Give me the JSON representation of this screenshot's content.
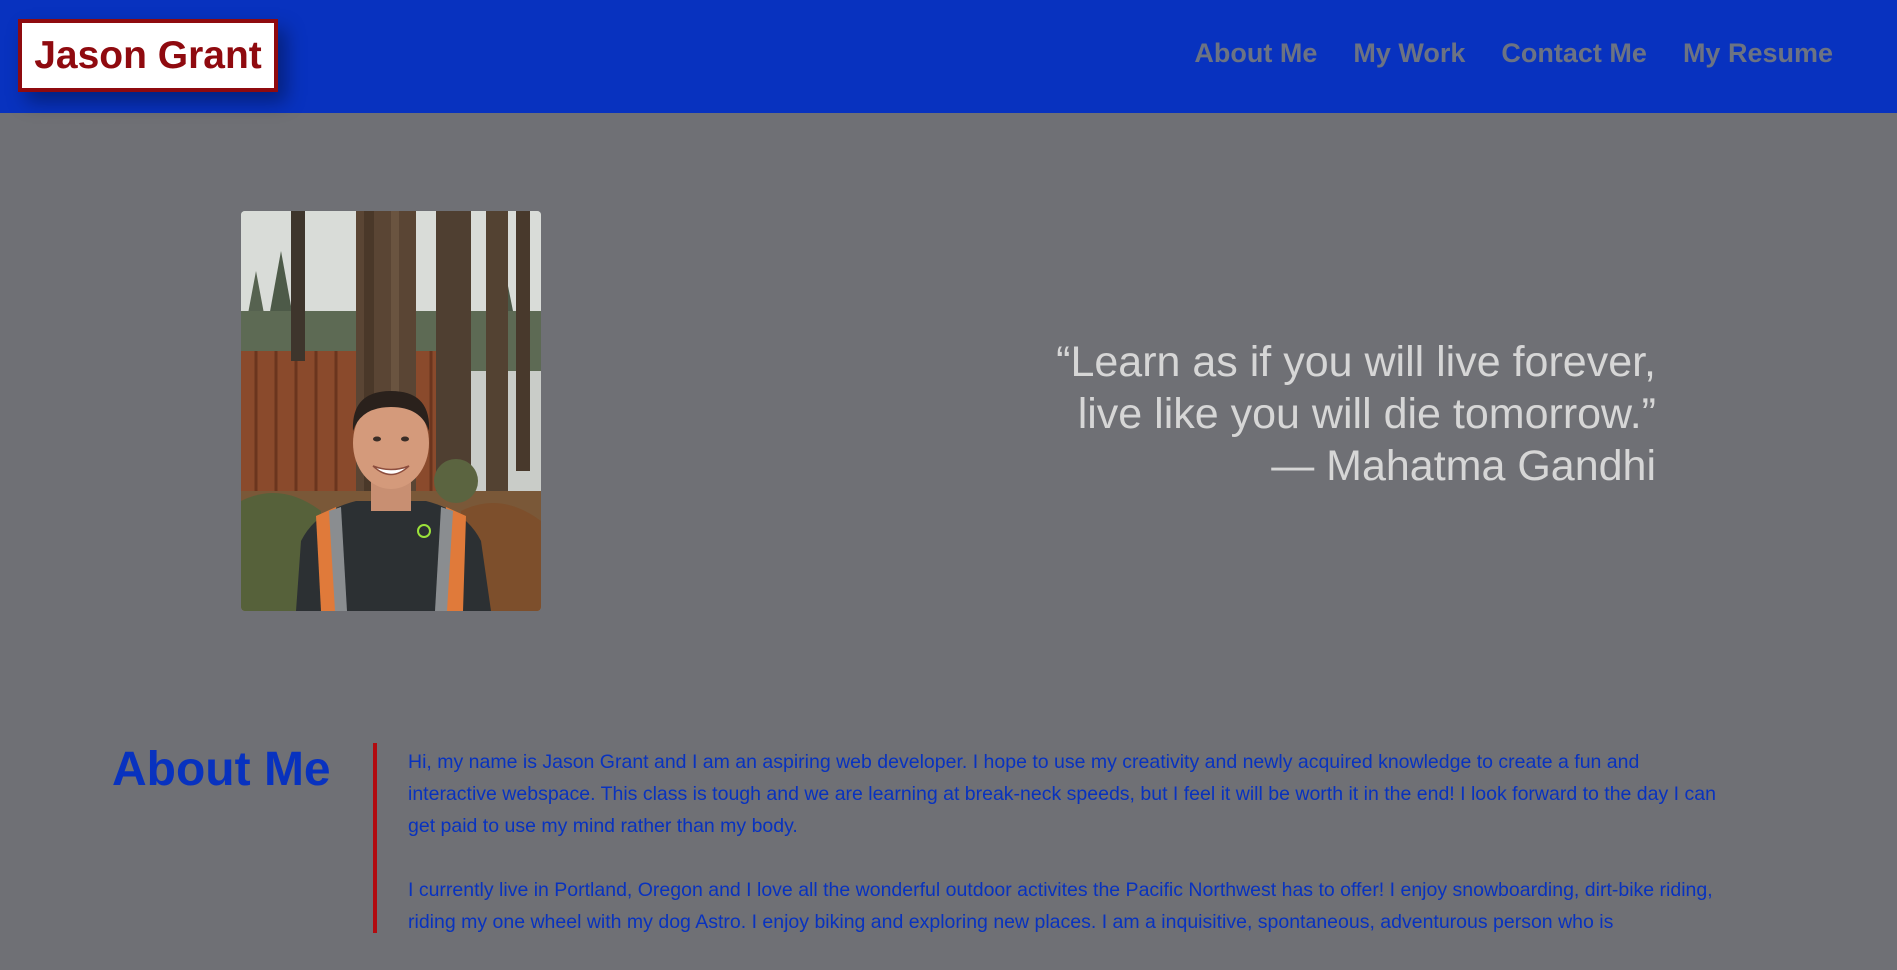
{
  "header": {
    "logo_text": "Jason Grant",
    "nav": [
      {
        "label": "About Me"
      },
      {
        "label": "My Work"
      },
      {
        "label": "Contact Me"
      },
      {
        "label": "My Resume"
      }
    ]
  },
  "hero": {
    "quote_lines": [
      "“Learn as if you will live forever,",
      "live like you will die tomorrow.”",
      "— Mahatma Gandhi"
    ]
  },
  "about": {
    "title": "About Me",
    "paragraphs": [
      "Hi, my name is Jason Grant and I am an aspiring web developer. I hope to use my creativity and newly acquired knowledge to create a fun and interactive webspace. This class is tough and we are learning at break-neck speeds, but I feel it will be worth it in the end! I look forward to the day I can get paid to use my mind rather than my body.",
      "I currently live in Portland, Oregon and I love all the wonderful outdoor activites the Pacific Northwest has to offer! I enjoy snowboarding, dirt-bike riding, riding my one wheel with my dog Astro. I enjoy biking and exploring new places. I am a inquisitive, spontaneous, adventurous person who is"
    ]
  },
  "colors": {
    "header_bg": "#0832bf",
    "page_bg": "#6f7075",
    "logo_red": "#8f0a0f",
    "accent_bar": "#b20b10",
    "about_text": "#0832bf",
    "quote_text": "#d6d6d6",
    "nav_text": "#6c7383"
  }
}
